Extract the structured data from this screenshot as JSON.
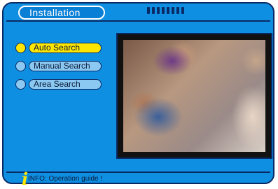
{
  "header": {
    "title": "Installation",
    "dot_count": 8
  },
  "menu": {
    "items": [
      {
        "label": "Auto Search",
        "selected": true
      },
      {
        "label": "Manual Search",
        "selected": false
      },
      {
        "label": "Area Search",
        "selected": false
      }
    ]
  },
  "footer": {
    "info_icon": "i",
    "info_text": "INFO: Operation guide !"
  },
  "colors": {
    "panel": "#0f8fe2",
    "outline": "#0a2a66",
    "highlight": "#ffe600",
    "pill": "#8cc9f2"
  }
}
